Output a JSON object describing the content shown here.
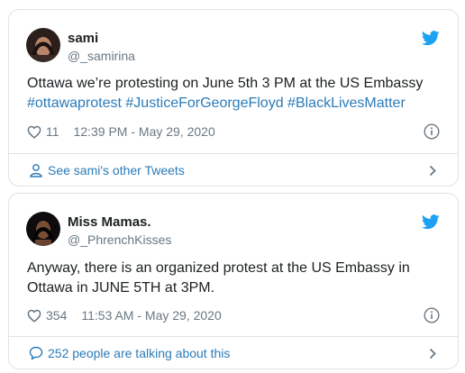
{
  "colors": {
    "text": "#1c2022",
    "muted": "#697882",
    "link": "#2b7bb9",
    "twitter_blue": "#1da1f2",
    "border": "#dfe3e6"
  },
  "tweets": [
    {
      "display_name": "sami",
      "handle": "@_samirina",
      "text_plain": "Ottawa we’re protesting on June 5th 3 PM at the US Embassy ",
      "hashtags": [
        "#ottawaprotest",
        "#JusticeForGeorgeFloyd",
        "#BlackLivesMatter"
      ],
      "likes": "11",
      "timestamp": "12:39 PM - May 29, 2020",
      "footer_label": "See sami's other Tweets",
      "footer_icon": "person-icon"
    },
    {
      "display_name": "Miss Mamas.",
      "handle": "@_PhrenchKisses",
      "text": "Anyway, there is an organized protest at the US Embassy in Ottawa in JUNE 5TH at 3PM.",
      "likes": "354",
      "timestamp": "11:53 AM - May 29, 2020",
      "footer_label": "252 people are talking about this",
      "footer_icon": "comment-bubble-icon"
    }
  ]
}
